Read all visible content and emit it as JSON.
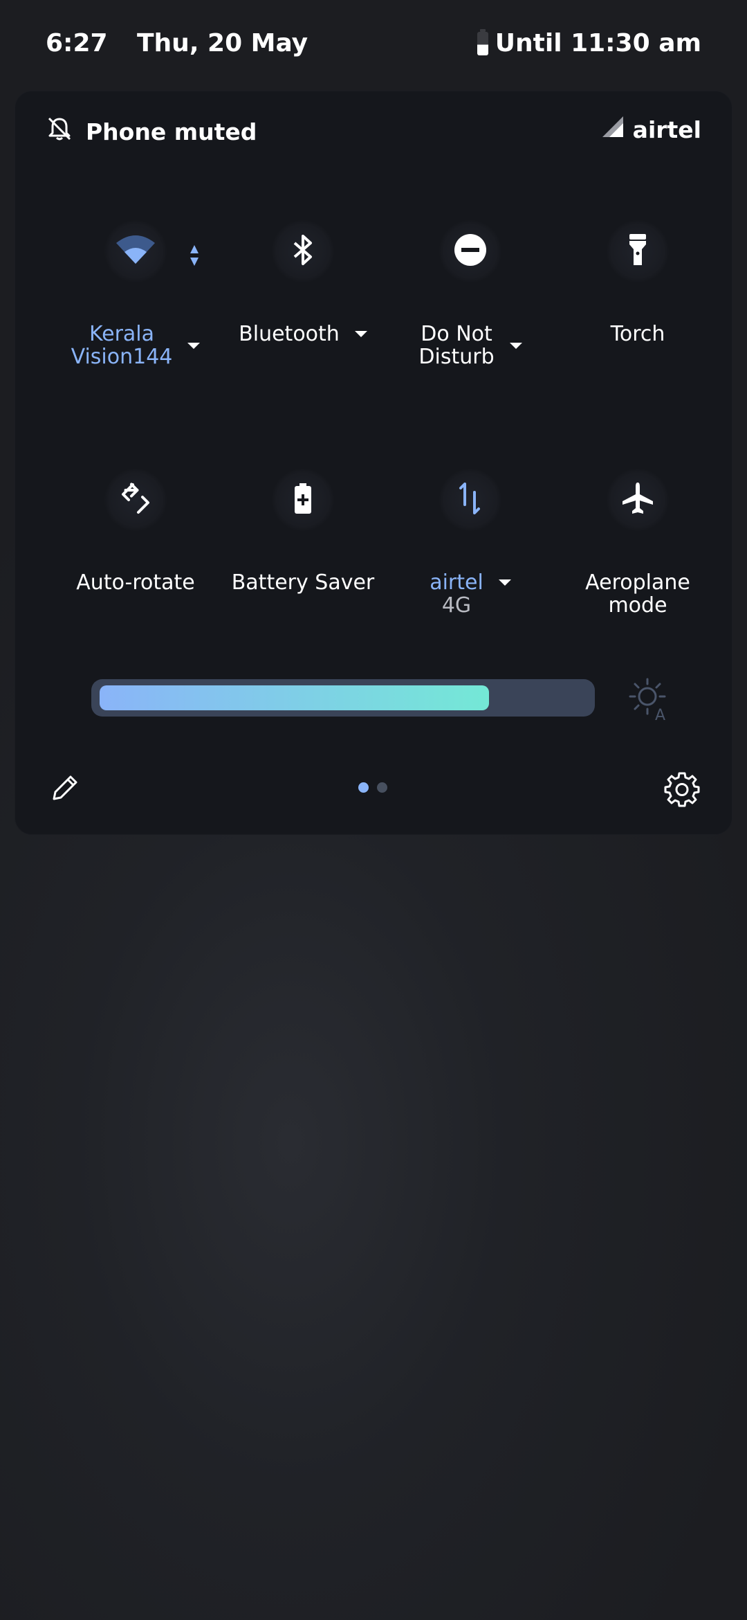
{
  "status_bar": {
    "time": "6:27",
    "date": "Thu, 20 May",
    "battery_text": "Until 11:30 am",
    "battery_icon": "battery-icon"
  },
  "panel": {
    "muted_label": "Phone muted",
    "muted_icon": "bell-off-icon",
    "carrier": "airtel",
    "carrier_icon": "signal-icon"
  },
  "tiles": [
    {
      "label": "Kerala",
      "label2": "Vision144",
      "active": true,
      "icon": "wifi-icon",
      "has_menu": true
    },
    {
      "label": "Bluetooth",
      "active": false,
      "icon": "bluetooth-icon",
      "has_menu": true
    },
    {
      "label": "Do Not",
      "label2": "Disturb",
      "active": false,
      "icon": "do-not-disturb-icon",
      "has_menu": true
    },
    {
      "label": "Torch",
      "active": false,
      "icon": "torch-icon",
      "has_menu": false
    },
    {
      "label": "Auto-rotate",
      "active": false,
      "icon": "auto-rotate-icon",
      "has_menu": false
    },
    {
      "label": "Battery Saver",
      "active": false,
      "icon": "battery-saver-icon",
      "has_menu": false
    },
    {
      "label": "airtel",
      "sub": "4G",
      "active": true,
      "icon": "mobile-data-icon",
      "has_menu": true
    },
    {
      "label": "Aeroplane",
      "label2": "mode",
      "active": false,
      "icon": "aeroplane-icon",
      "has_menu": false
    }
  ],
  "brightness": {
    "level": 0.8,
    "auto_icon": "brightness-auto-icon"
  },
  "pager": {
    "pages": 2,
    "current": 1
  },
  "colors": {
    "accent": "#8ab4f8",
    "accent_end": "#74e8d6",
    "panel": "#15171c",
    "text": "#ffffff"
  }
}
